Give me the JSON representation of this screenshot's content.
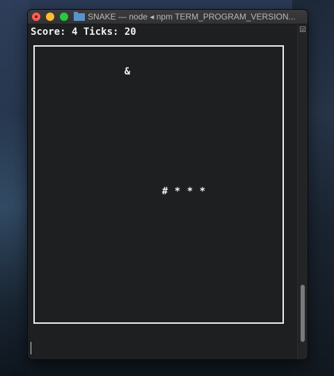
{
  "window": {
    "title": "SNAKE — node ◂ npm TERM_PROGRAM_VERSION..."
  },
  "terminal": {
    "status_line": "Score: 4 Ticks: 20",
    "food_glyph": "&",
    "snake": {
      "head_glyph": "#",
      "body_glyph": "*",
      "length": 4
    },
    "scroll_position": 0.95
  },
  "colors": {
    "close": "#fe5f57",
    "minimize": "#febc2e",
    "zoom": "#28c840",
    "terminal_bg": "#1d1f21",
    "text": "#f2f2f2"
  },
  "icons": [
    "close-icon",
    "minimize-icon",
    "zoom-icon",
    "folder-icon",
    "scrollbar-menu-icon"
  ]
}
